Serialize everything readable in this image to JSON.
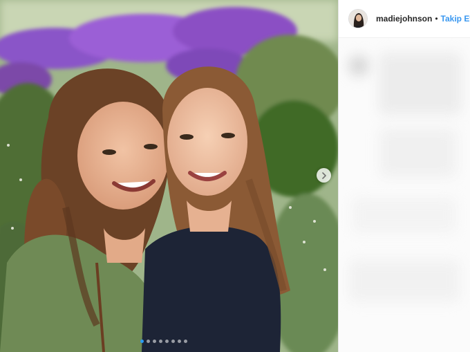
{
  "post": {
    "username": "madiejohnson",
    "separator": "•",
    "follow_label": "Takip Et",
    "carousel": {
      "dot_count": 8,
      "active_index": 0
    }
  },
  "icons": {
    "next": "chevron-right-icon"
  },
  "colors": {
    "follow_blue": "#3897f0",
    "active_dot": "#2b9cf5"
  }
}
